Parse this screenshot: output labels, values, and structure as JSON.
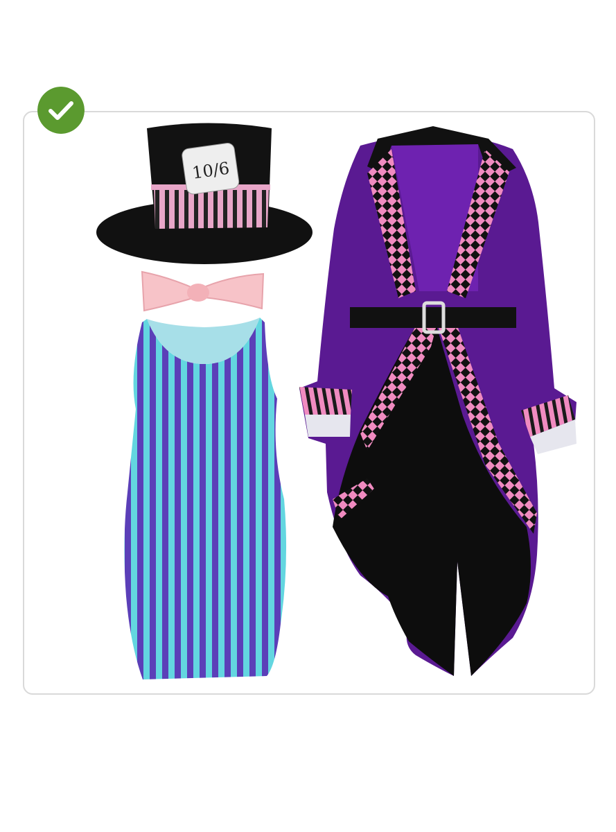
{
  "badge": {
    "icon": "checkmark-icon",
    "color": "#5b9a2f"
  },
  "hat": {
    "card_text": "10/6"
  },
  "colors": {
    "hat": "#111111",
    "hat_band_pink": "#e8a6c8",
    "bow": "#f7c3c8",
    "dress_stripe_a": "#5b3fb8",
    "dress_stripe_b": "#63d6e0",
    "coat": "#5a1a92",
    "coat_check": "#f08bc0",
    "coat_lining": "#0d0d0d"
  }
}
